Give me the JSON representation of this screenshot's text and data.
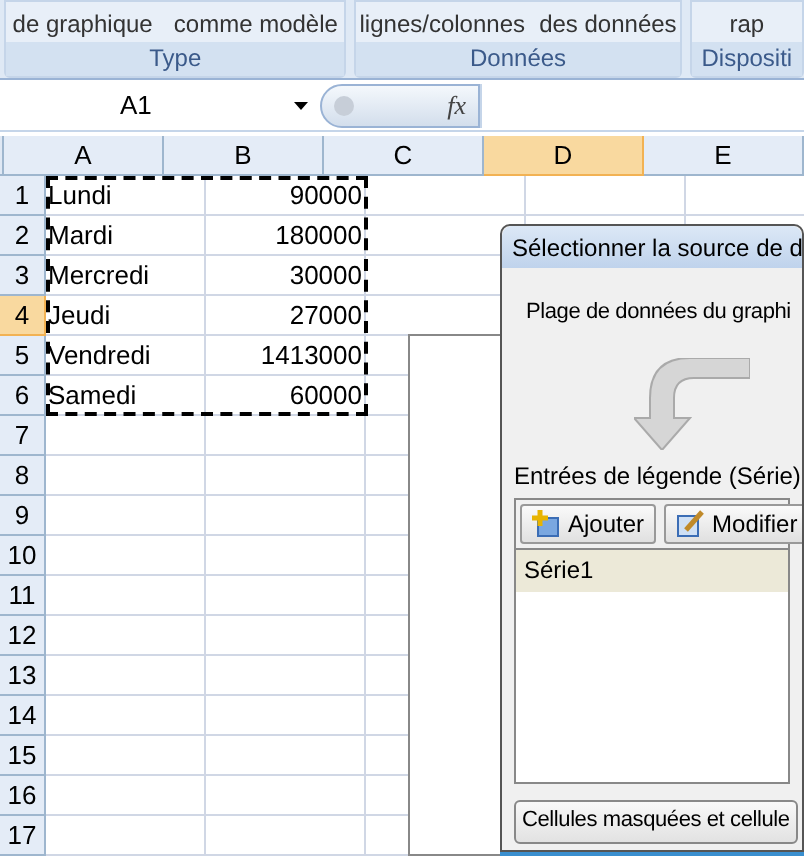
{
  "ribbon": {
    "groups": [
      {
        "label": "Type",
        "buttons": [
          "de graphique",
          "comme modèle"
        ]
      },
      {
        "label": "Données",
        "buttons": [
          "lignes/colonnes",
          "des données"
        ]
      },
      {
        "label": "Dispositi",
        "buttons": [
          "rap"
        ]
      }
    ]
  },
  "formula_bar": {
    "name_box": "A1",
    "fx": "fx"
  },
  "sheet": {
    "columns": [
      {
        "label": "A",
        "selected": false
      },
      {
        "label": "B",
        "selected": false
      },
      {
        "label": "C",
        "selected": false
      },
      {
        "label": "D",
        "selected": true
      },
      {
        "label": "E",
        "selected": false
      }
    ],
    "rows": [
      {
        "label": "1",
        "selected": false,
        "cells": [
          "Lundi",
          "90000"
        ]
      },
      {
        "label": "2",
        "selected": false,
        "cells": [
          "Mardi",
          "180000"
        ]
      },
      {
        "label": "3",
        "selected": false,
        "cells": [
          "Mercredi",
          "30000"
        ]
      },
      {
        "label": "4",
        "selected": true,
        "cells": [
          "Jeudi",
          "27000"
        ]
      },
      {
        "label": "5",
        "selected": false,
        "cells": [
          "Vendredi",
          "1413000"
        ]
      },
      {
        "label": "6",
        "selected": false,
        "cells": [
          "Samedi",
          "60000"
        ]
      },
      {
        "label": "7",
        "selected": false,
        "cells": []
      },
      {
        "label": "8",
        "selected": false,
        "cells": []
      },
      {
        "label": "9",
        "selected": false,
        "cells": []
      },
      {
        "label": "10",
        "selected": false,
        "cells": []
      },
      {
        "label": "11",
        "selected": false,
        "cells": []
      },
      {
        "label": "12",
        "selected": false,
        "cells": []
      },
      {
        "label": "13",
        "selected": false,
        "cells": []
      },
      {
        "label": "14",
        "selected": false,
        "cells": []
      },
      {
        "label": "15",
        "selected": false,
        "cells": []
      },
      {
        "label": "16",
        "selected": false,
        "cells": []
      },
      {
        "label": "17",
        "selected": false,
        "cells": []
      }
    ]
  },
  "dialog": {
    "title": "Sélectionner la source de d",
    "range_label": "Plage de données du graphi",
    "legend_label": "Entrées de légende (Série)",
    "buttons": [
      "Ajouter",
      "Modifier"
    ],
    "series": [
      {
        "name": "Série1",
        "selected": true
      }
    ],
    "hidden_cells_button": "Cellules masquées et cellule"
  }
}
